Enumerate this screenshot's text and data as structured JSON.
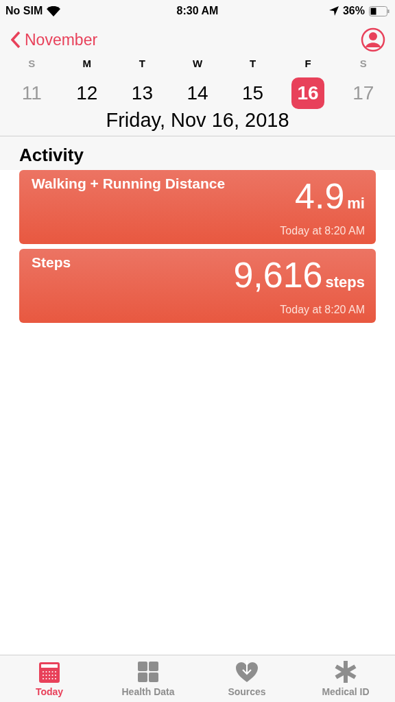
{
  "status_bar": {
    "carrier": "No SIM",
    "time": "8:30 AM",
    "battery": "36%"
  },
  "nav": {
    "back": "November"
  },
  "week": [
    {
      "letter": "S",
      "day": "11",
      "dimmed": true,
      "selected": false
    },
    {
      "letter": "M",
      "day": "12",
      "dimmed": false,
      "selected": false
    },
    {
      "letter": "T",
      "day": "13",
      "dimmed": false,
      "selected": false
    },
    {
      "letter": "W",
      "day": "14",
      "dimmed": false,
      "selected": false
    },
    {
      "letter": "T",
      "day": "15",
      "dimmed": false,
      "selected": false
    },
    {
      "letter": "F",
      "day": "16",
      "dimmed": false,
      "selected": true
    },
    {
      "letter": "S",
      "day": "17",
      "dimmed": true,
      "selected": false
    }
  ],
  "date_title": "Friday, Nov 16, 2018",
  "section_title": "Activity",
  "cards": [
    {
      "title": "Walking + Running Distance",
      "value": "4.9",
      "unit": "mi",
      "time": "Today at 8:20 AM"
    },
    {
      "title": "Steps",
      "value": "9,616",
      "unit": "steps",
      "time": "Today at 8:20 AM"
    }
  ],
  "tabs": [
    {
      "kind": "calendar",
      "label": "Today",
      "selected": true
    },
    {
      "kind": "grid",
      "label": "Health Data",
      "selected": false
    },
    {
      "kind": "heart",
      "label": "Sources",
      "selected": false
    },
    {
      "kind": "asterisk",
      "label": "Medical ID",
      "selected": false
    }
  ]
}
